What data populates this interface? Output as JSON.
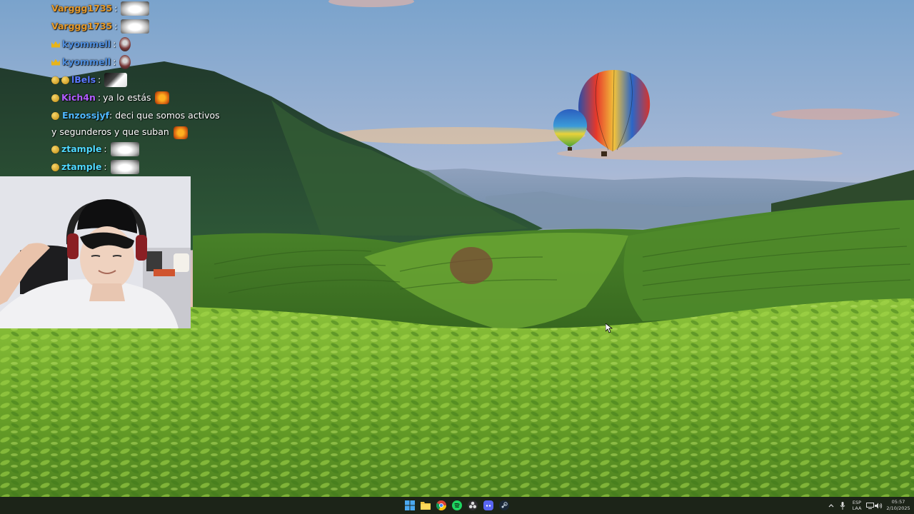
{
  "chat": {
    "messages": [
      {
        "user": "Varggg1735",
        "text": "",
        "user_color": "#e59a2b",
        "badges": [],
        "emote": "white-blob"
      },
      {
        "user": "Varggg1735",
        "text": "",
        "user_color": "#e59a2b",
        "badges": [],
        "emote": "white-blob"
      },
      {
        "user": "kyommell",
        "text": "",
        "user_color": "#4f8fe0",
        "badges": [
          "crown"
        ],
        "emote": "skull"
      },
      {
        "user": "kyommell",
        "text": "",
        "user_color": "#4f8fe0",
        "badges": [
          "crown"
        ],
        "emote": "skull"
      },
      {
        "user": "lBels",
        "text": "",
        "user_color": "#5b79ff",
        "badges": [
          "gold",
          "gold"
        ],
        "emote": "dark-face"
      },
      {
        "user": "Kich4n",
        "text": "ya lo estás",
        "user_color": "#b15cff",
        "badges": [
          "gold"
        ],
        "emote": "cat"
      },
      {
        "user": "Enzossjyf",
        "text": "deci que somos activos y segunderos y que suban",
        "user_color": "#4fb8ff",
        "badges": [
          "gold"
        ],
        "emote": "cat"
      },
      {
        "user": "ztample",
        "text": "",
        "user_color": "#4fd9ff",
        "badges": [
          "gold"
        ],
        "emote": "white-blob"
      },
      {
        "user": "ztample",
        "text": "",
        "user_color": "#4fd9ff",
        "badges": [
          "gold"
        ],
        "emote": "white-blob"
      }
    ]
  },
  "taskbar": {
    "apps": [
      {
        "icon": "windows-start-icon",
        "label": "Start"
      },
      {
        "icon": "file-explorer-icon",
        "label": "File Explorer"
      },
      {
        "icon": "chrome-icon",
        "label": "Google Chrome"
      },
      {
        "icon": "spotify-icon",
        "label": "Spotify"
      },
      {
        "icon": "obs-icon",
        "label": "OBS Studio"
      },
      {
        "icon": "discord-icon",
        "label": "Discord"
      },
      {
        "icon": "steam-icon",
        "label": "Steam"
      }
    ],
    "language_top": "ESP",
    "language_bottom": "LAA",
    "time": "05:57",
    "date": "2/10/2025"
  },
  "colors": {
    "taskbar_bg": "#1c2418",
    "sky_top": "#7fa7cf",
    "sunset": "#f6b98a",
    "field_green": "#7fb52c"
  }
}
